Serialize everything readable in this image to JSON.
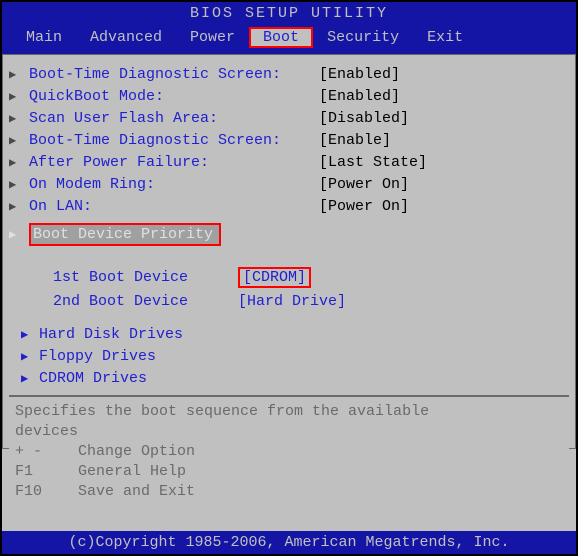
{
  "header": {
    "title": "BIOS SETUP UTILITY"
  },
  "menubar": {
    "items": [
      {
        "label": "Main"
      },
      {
        "label": "Advanced"
      },
      {
        "label": "Power"
      },
      {
        "label": "Boot"
      },
      {
        "label": "Security"
      },
      {
        "label": "Exit"
      }
    ],
    "active_index": 3
  },
  "settings": [
    {
      "label": "Boot-Time Diagnostic Screen:",
      "value": "[Enabled]"
    },
    {
      "label": "QuickBoot Mode:",
      "value": "[Enabled]"
    },
    {
      "label": "Scan User Flash Area:",
      "value": "[Disabled]"
    },
    {
      "label": "Boot-Time Diagnostic Screen:",
      "value": "[Enable]"
    },
    {
      "label": "After Power Failure:",
      "value": "[Last State]"
    },
    {
      "label": "On Modem Ring:",
      "value": "[Power On]"
    },
    {
      "label": "On LAN:",
      "value": "[Power On]"
    }
  ],
  "boot_priority": {
    "label": "Boot Device Priority",
    "devices": [
      {
        "label": "1st Boot Device",
        "value": "[CDROM]",
        "boxed": true
      },
      {
        "label": "2nd Boot Device",
        "value": "[Hard Drive]",
        "boxed": false
      }
    ]
  },
  "drive_menus": [
    {
      "label": "Hard Disk Drives"
    },
    {
      "label": "Floppy Drives"
    },
    {
      "label": "CDROM Drives"
    }
  ],
  "help": {
    "line1": "Specifies the boot sequence from the available",
    "line2": "devices",
    "line3": "+ -    Change Option",
    "line4": "F1     General Help",
    "line5": "F10    Save and Exit"
  },
  "footer": {
    "text": "(c)Copyright 1985-2006, American Megatrends, Inc."
  }
}
